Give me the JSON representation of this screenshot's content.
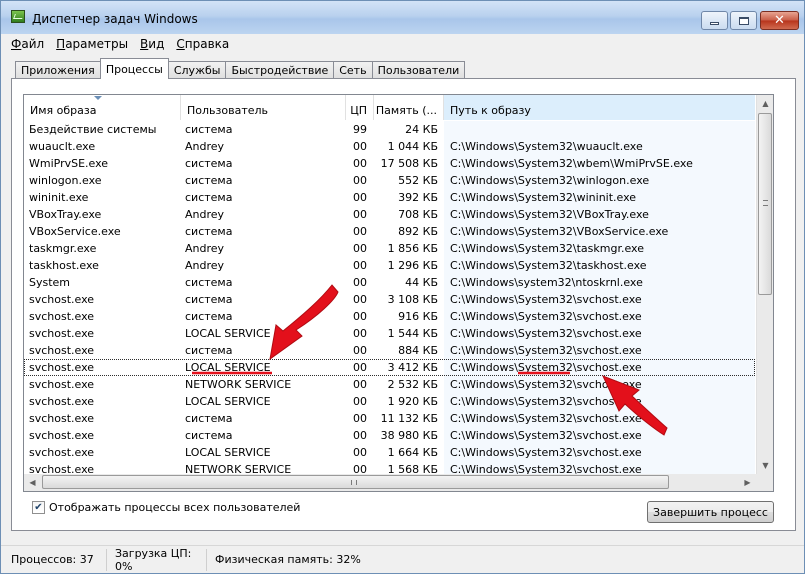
{
  "window": {
    "title": "Диспетчер задач Windows"
  },
  "menu": [
    {
      "label": "Файл",
      "ul": "Ф",
      "rest": "айл"
    },
    {
      "label": "Параметры",
      "ul": "П",
      "rest": "араметры"
    },
    {
      "label": "Вид",
      "ul": "В",
      "rest": "ид"
    },
    {
      "label": "Справка",
      "ul": "С",
      "rest": "правка"
    }
  ],
  "tabs": [
    "Приложения",
    "Процессы",
    "Службы",
    "Быстродействие",
    "Сеть",
    "Пользователи"
  ],
  "active_tab": "Процессы",
  "columns": {
    "name": "Имя образа",
    "user": "Пользователь",
    "cpu": "ЦП",
    "mem": "Память (...",
    "path": "Путь к образу"
  },
  "rows": [
    {
      "name": "Бездействие системы",
      "user": "система",
      "cpu": "99",
      "mem": "24 КБ",
      "path": ""
    },
    {
      "name": "wuauclt.exe",
      "user": "Andrey",
      "cpu": "00",
      "mem": "1 044 КБ",
      "path": "C:\\Windows\\System32\\wuauclt.exe"
    },
    {
      "name": "WmiPrvSE.exe",
      "user": "система",
      "cpu": "00",
      "mem": "17 508 КБ",
      "path": "C:\\Windows\\System32\\wbem\\WmiPrvSE.exe"
    },
    {
      "name": "winlogon.exe",
      "user": "система",
      "cpu": "00",
      "mem": "552 КБ",
      "path": "C:\\Windows\\System32\\winlogon.exe"
    },
    {
      "name": "wininit.exe",
      "user": "система",
      "cpu": "00",
      "mem": "392 КБ",
      "path": "C:\\Windows\\System32\\wininit.exe"
    },
    {
      "name": "VBoxTray.exe",
      "user": "Andrey",
      "cpu": "00",
      "mem": "708 КБ",
      "path": "C:\\Windows\\System32\\VBoxTray.exe"
    },
    {
      "name": "VBoxService.exe",
      "user": "система",
      "cpu": "00",
      "mem": "892 КБ",
      "path": "C:\\Windows\\System32\\VBoxService.exe"
    },
    {
      "name": "taskmgr.exe",
      "user": "Andrey",
      "cpu": "00",
      "mem": "1 856 КБ",
      "path": "C:\\Windows\\System32\\taskmgr.exe"
    },
    {
      "name": "taskhost.exe",
      "user": "Andrey",
      "cpu": "00",
      "mem": "1 296 КБ",
      "path": "C:\\Windows\\System32\\taskhost.exe"
    },
    {
      "name": "System",
      "user": "система",
      "cpu": "00",
      "mem": "44 КБ",
      "path": "C:\\Windows\\system32\\ntoskrnl.exe"
    },
    {
      "name": "svchost.exe",
      "user": "система",
      "cpu": "00",
      "mem": "3 108 КБ",
      "path": "C:\\Windows\\System32\\svchost.exe"
    },
    {
      "name": "svchost.exe",
      "user": "система",
      "cpu": "00",
      "mem": "916 КБ",
      "path": "C:\\Windows\\System32\\svchost.exe"
    },
    {
      "name": "svchost.exe",
      "user": "LOCAL SERVICE",
      "cpu": "00",
      "mem": "1 544 КБ",
      "path": "C:\\Windows\\System32\\svchost.exe"
    },
    {
      "name": "svchost.exe",
      "user": "система",
      "cpu": "00",
      "mem": "884 КБ",
      "path": "C:\\Windows\\System32\\svchost.exe"
    },
    {
      "name": "svchost.exe",
      "user": "LOCAL SERVICE",
      "cpu": "00",
      "mem": "3 412 КБ",
      "path": "C:\\Windows\\System32\\svchost.exe",
      "selected": true
    },
    {
      "name": "svchost.exe",
      "user": "NETWORK SERVICE",
      "cpu": "00",
      "mem": "2 532 КБ",
      "path": "C:\\Windows\\System32\\svchost.exe"
    },
    {
      "name": "svchost.exe",
      "user": "LOCAL SERVICE",
      "cpu": "00",
      "mem": "1 920 КБ",
      "path": "C:\\Windows\\System32\\svchost.exe"
    },
    {
      "name": "svchost.exe",
      "user": "система",
      "cpu": "00",
      "mem": "11 132 КБ",
      "path": "C:\\Windows\\System32\\svchost.exe"
    },
    {
      "name": "svchost.exe",
      "user": "система",
      "cpu": "00",
      "mem": "38 980 КБ",
      "path": "C:\\Windows\\System32\\svchost.exe"
    },
    {
      "name": "svchost.exe",
      "user": "LOCAL SERVICE",
      "cpu": "00",
      "mem": "1 664 КБ",
      "path": "C:\\Windows\\System32\\svchost.exe"
    },
    {
      "name": "svchost.exe",
      "user": "NETWORK SERVICE",
      "cpu": "00",
      "mem": "1 568 КБ",
      "path": "C:\\Windows\\System32\\svchost.exe"
    }
  ],
  "show_all_label": "Отображать процессы всех пользователей",
  "show_all_checked": true,
  "end_process_label": "Завершить процесс",
  "status": {
    "processes": "Процессов: 37",
    "cpu_load": "Загрузка ЦП: 0%",
    "memory": "Физическая память: 32%"
  },
  "colors": {
    "annotation_red": "#e3101b",
    "selection_header": "#dceefc"
  },
  "icons": {
    "app": "task-manager-icon",
    "minimize": "minimize-icon",
    "maximize": "maximize-icon",
    "close": "close-icon",
    "check": "checkmark-icon"
  }
}
